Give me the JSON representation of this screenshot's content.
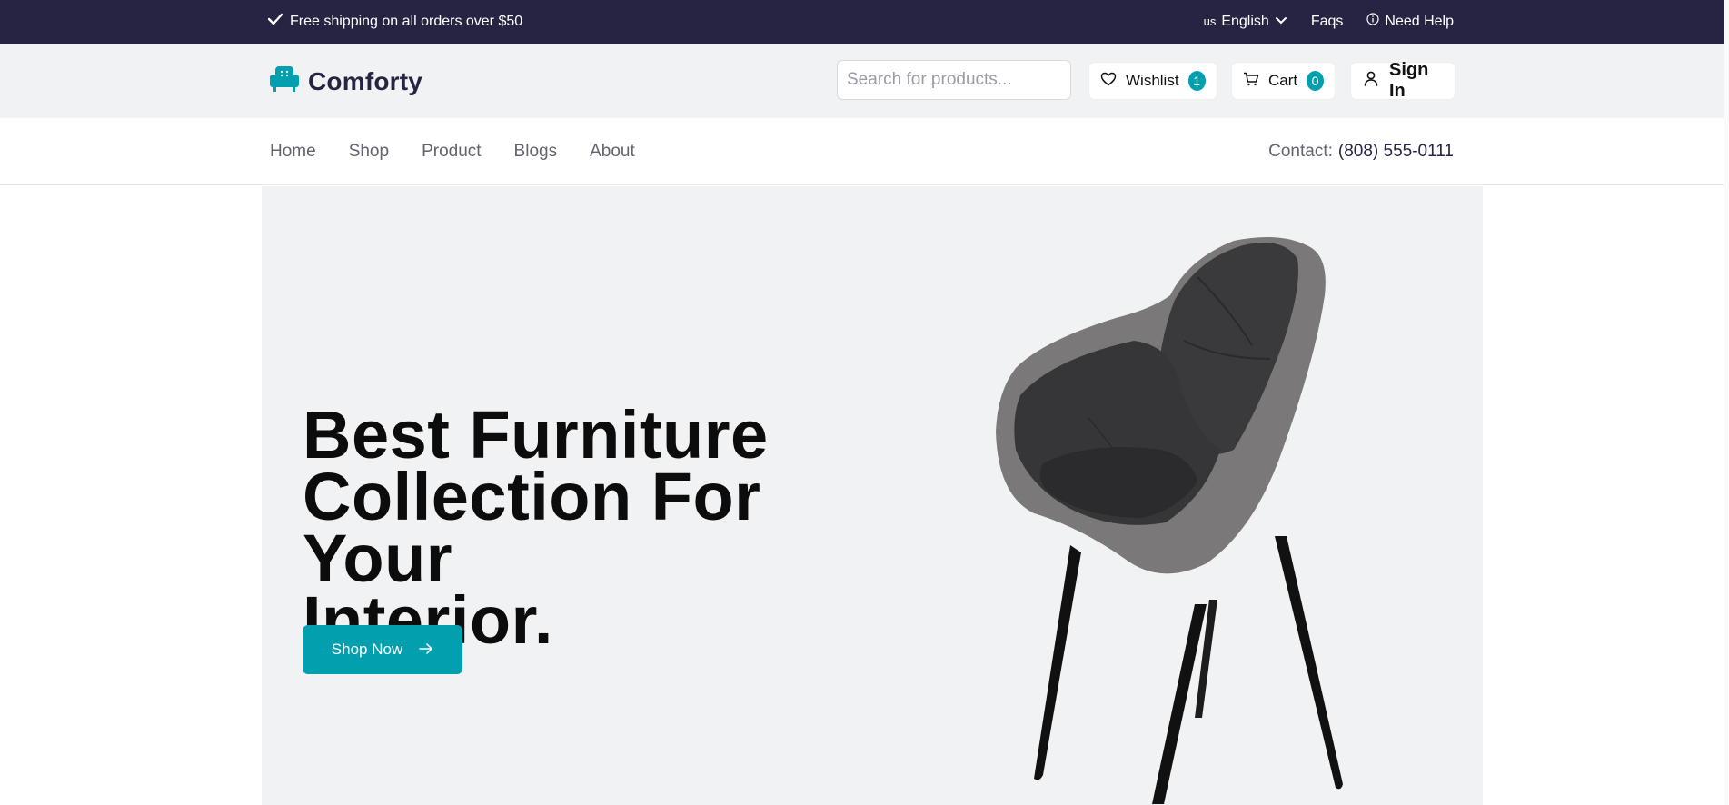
{
  "topbar": {
    "shipping_text": "Free shipping on all orders over $50",
    "language_code": "us",
    "language": "English",
    "faqs": "Faqs",
    "need_help": "Need Help"
  },
  "header": {
    "brand": "Comforty",
    "search_placeholder": "Search for products...",
    "wishlist_label": "Wishlist",
    "wishlist_count": "1",
    "cart_label": "Cart",
    "cart_count": "0",
    "signin_label": "Sign In"
  },
  "nav": {
    "items": [
      {
        "label": "Home"
      },
      {
        "label": "Shop"
      },
      {
        "label": "Product"
      },
      {
        "label": "Blogs"
      },
      {
        "label": "About"
      }
    ],
    "contact_label": "Contact:",
    "contact_number": "(808) 555-0111"
  },
  "hero": {
    "heading_line1": "Best Furniture",
    "heading_line2": "Collection For Your",
    "heading_line3": "Interior.",
    "button_label": "Shop Now"
  },
  "colors": {
    "topbar_bg": "#272343",
    "accent": "#029fae",
    "header_bg": "#f0f2f3"
  }
}
